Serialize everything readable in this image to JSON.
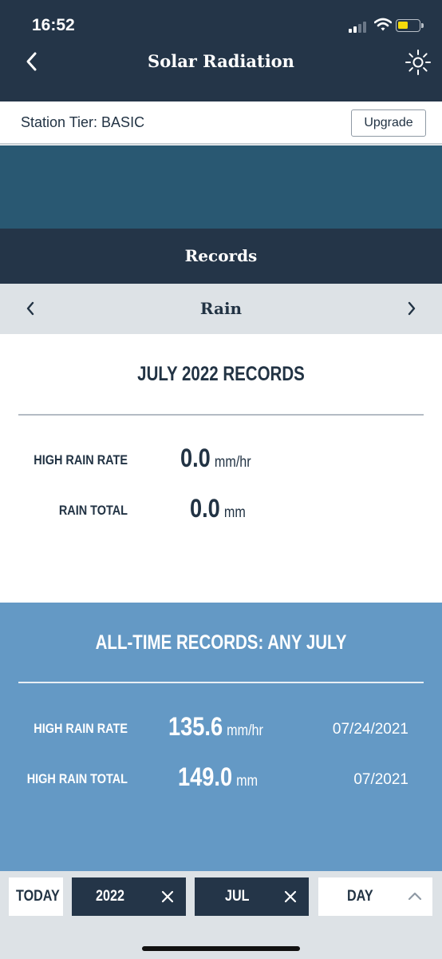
{
  "status_bar": {
    "time": "16:52"
  },
  "header": {
    "title": "Solar Radiation",
    "back_icon": "chevron-left-icon",
    "action_icon": "sun-icon"
  },
  "tier": {
    "label": "Station Tier: BASIC",
    "upgrade_label": "Upgrade"
  },
  "records": {
    "header": "Records"
  },
  "selector": {
    "label": "Rain"
  },
  "month_records": {
    "title": "JULY 2022 RECORDS",
    "rows": [
      {
        "label": "HIGH RAIN RATE",
        "value": "0.0",
        "unit": "mm/hr"
      },
      {
        "label": "RAIN TOTAL",
        "value": "0.0",
        "unit": "mm"
      }
    ]
  },
  "alltime_records": {
    "title": "ALL-TIME RECORDS: ANY JULY",
    "rows": [
      {
        "label": "HIGH RAIN RATE",
        "value": "135.6",
        "unit": "mm/hr",
        "date": "07/24/2021"
      },
      {
        "label": "HIGH RAIN TOTAL",
        "value": "149.0",
        "unit": "mm",
        "date": "07/2021"
      }
    ]
  },
  "footer": {
    "today": "TODAY",
    "year": "2022",
    "month": "JUL",
    "period": "DAY"
  },
  "colors": {
    "header_bg": "#243548",
    "teal_band": "#295872",
    "alltime_bg": "#6499c5",
    "selector_bg": "#dde2e6",
    "battery": "#f5d90a"
  }
}
